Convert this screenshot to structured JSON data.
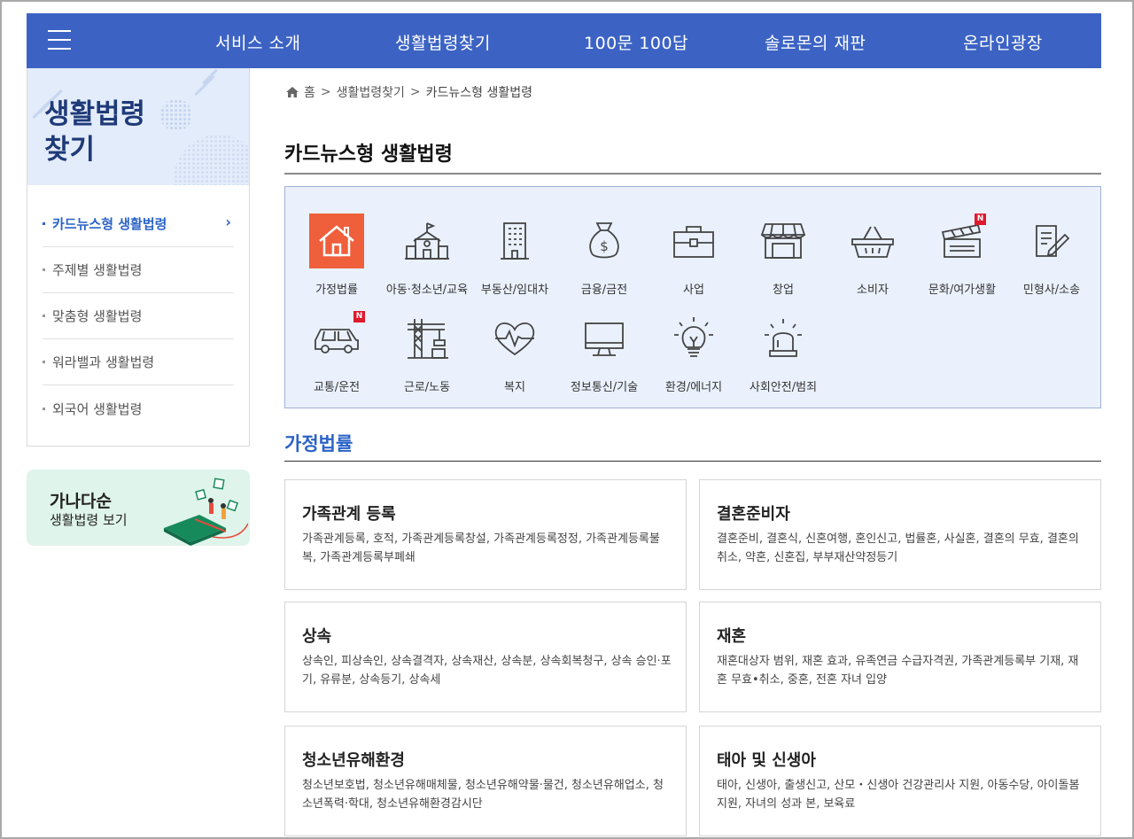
{
  "nav": {
    "items": [
      "서비스 소개",
      "생활법령찾기",
      "100문 100답",
      "솔로몬의 재판",
      "온라인광장"
    ]
  },
  "sidebar": {
    "title": "생활법령\n찾기",
    "items": [
      {
        "label": "카드뉴스형 생활법령",
        "active": true
      },
      {
        "label": "주제별 생활법령",
        "active": false
      },
      {
        "label": "맞춤형 생활법령",
        "active": false
      },
      {
        "label": "워라밸과 생활법령",
        "active": false
      },
      {
        "label": "외국어 생활법령",
        "active": false
      }
    ],
    "chevron": "›",
    "banner": {
      "line1": "가나다순",
      "line2": "생활법령 보기"
    }
  },
  "breadcrumb": {
    "home": "홈",
    "sep": ">",
    "level1": "생활법령찾기",
    "current": "카드뉴스형 생활법령"
  },
  "page_title": "카드뉴스형 생활법령",
  "categories": [
    {
      "label": "가정법률",
      "icon": "house-icon",
      "selected": true
    },
    {
      "label": "아동·청소년/교육",
      "icon": "school-icon"
    },
    {
      "label": "부동산/임대차",
      "icon": "building-icon"
    },
    {
      "label": "금융/금전",
      "icon": "money-bag-icon"
    },
    {
      "label": "사업",
      "icon": "briefcase-icon"
    },
    {
      "label": "창업",
      "icon": "store-icon"
    },
    {
      "label": "소비자",
      "icon": "basket-icon"
    },
    {
      "label": "문화/여가생활",
      "icon": "clapperboard-icon",
      "new": "N"
    },
    {
      "label": "민형사/소송",
      "icon": "document-pen-icon"
    },
    {
      "label": "교통/운전",
      "icon": "car-icon",
      "new": "N"
    },
    {
      "label": "근로/노동",
      "icon": "crane-icon"
    },
    {
      "label": "복지",
      "icon": "heart-pulse-icon"
    },
    {
      "label": "정보통신/기술",
      "icon": "monitor-icon"
    },
    {
      "label": "환경/에너지",
      "icon": "lightbulb-icon"
    },
    {
      "label": "사회안전/범죄",
      "icon": "siren-icon"
    }
  ],
  "section_title": "가정법률",
  "cards": [
    {
      "title": "가족관계 등록",
      "desc": "가족관계등록, 호적, 가족관계등록창설, 가족관계등록정정, 가족관계등록불복, 가족관계등록부폐쇄"
    },
    {
      "title": "결혼준비자",
      "desc": "결혼준비, 결혼식, 신혼여행, 혼인신고, 법률혼, 사실혼, 결혼의 무효, 결혼의 취소, 약혼, 신혼집, 부부재산약정등기"
    },
    {
      "title": "상속",
      "desc": "상속인, 피상속인, 상속결격자, 상속재산, 상속분, 상속회복청구, 상속 승인·포기, 유류분, 상속등기, 상속세"
    },
    {
      "title": "재혼",
      "desc": "재혼대상자 범위, 재혼 효과, 유족연금 수급자격권, 가족관계등록부 기재, 재혼 무효•취소, 중혼, 전혼 자녀 입양"
    },
    {
      "title": "청소년유해환경",
      "desc": "청소년보호법, 청소년유해매체물, 청소년유해약물·물건, 청소년유해업소, 청소년폭력·학대, 청소년유해환경감시단"
    },
    {
      "title": "태아 및 신생아",
      "desc": "태아, 신생아, 출생신고, 산모・신생아 건강관리사 지원, 아동수당, 아이돌봄 지원, 자녀의 성과 본, 보육료"
    }
  ],
  "colors": {
    "nav": "#3c63c4",
    "accent": "#2b63c6",
    "selected_icon_bg": "#ef5f3b",
    "new_badge": "#e0192c"
  }
}
